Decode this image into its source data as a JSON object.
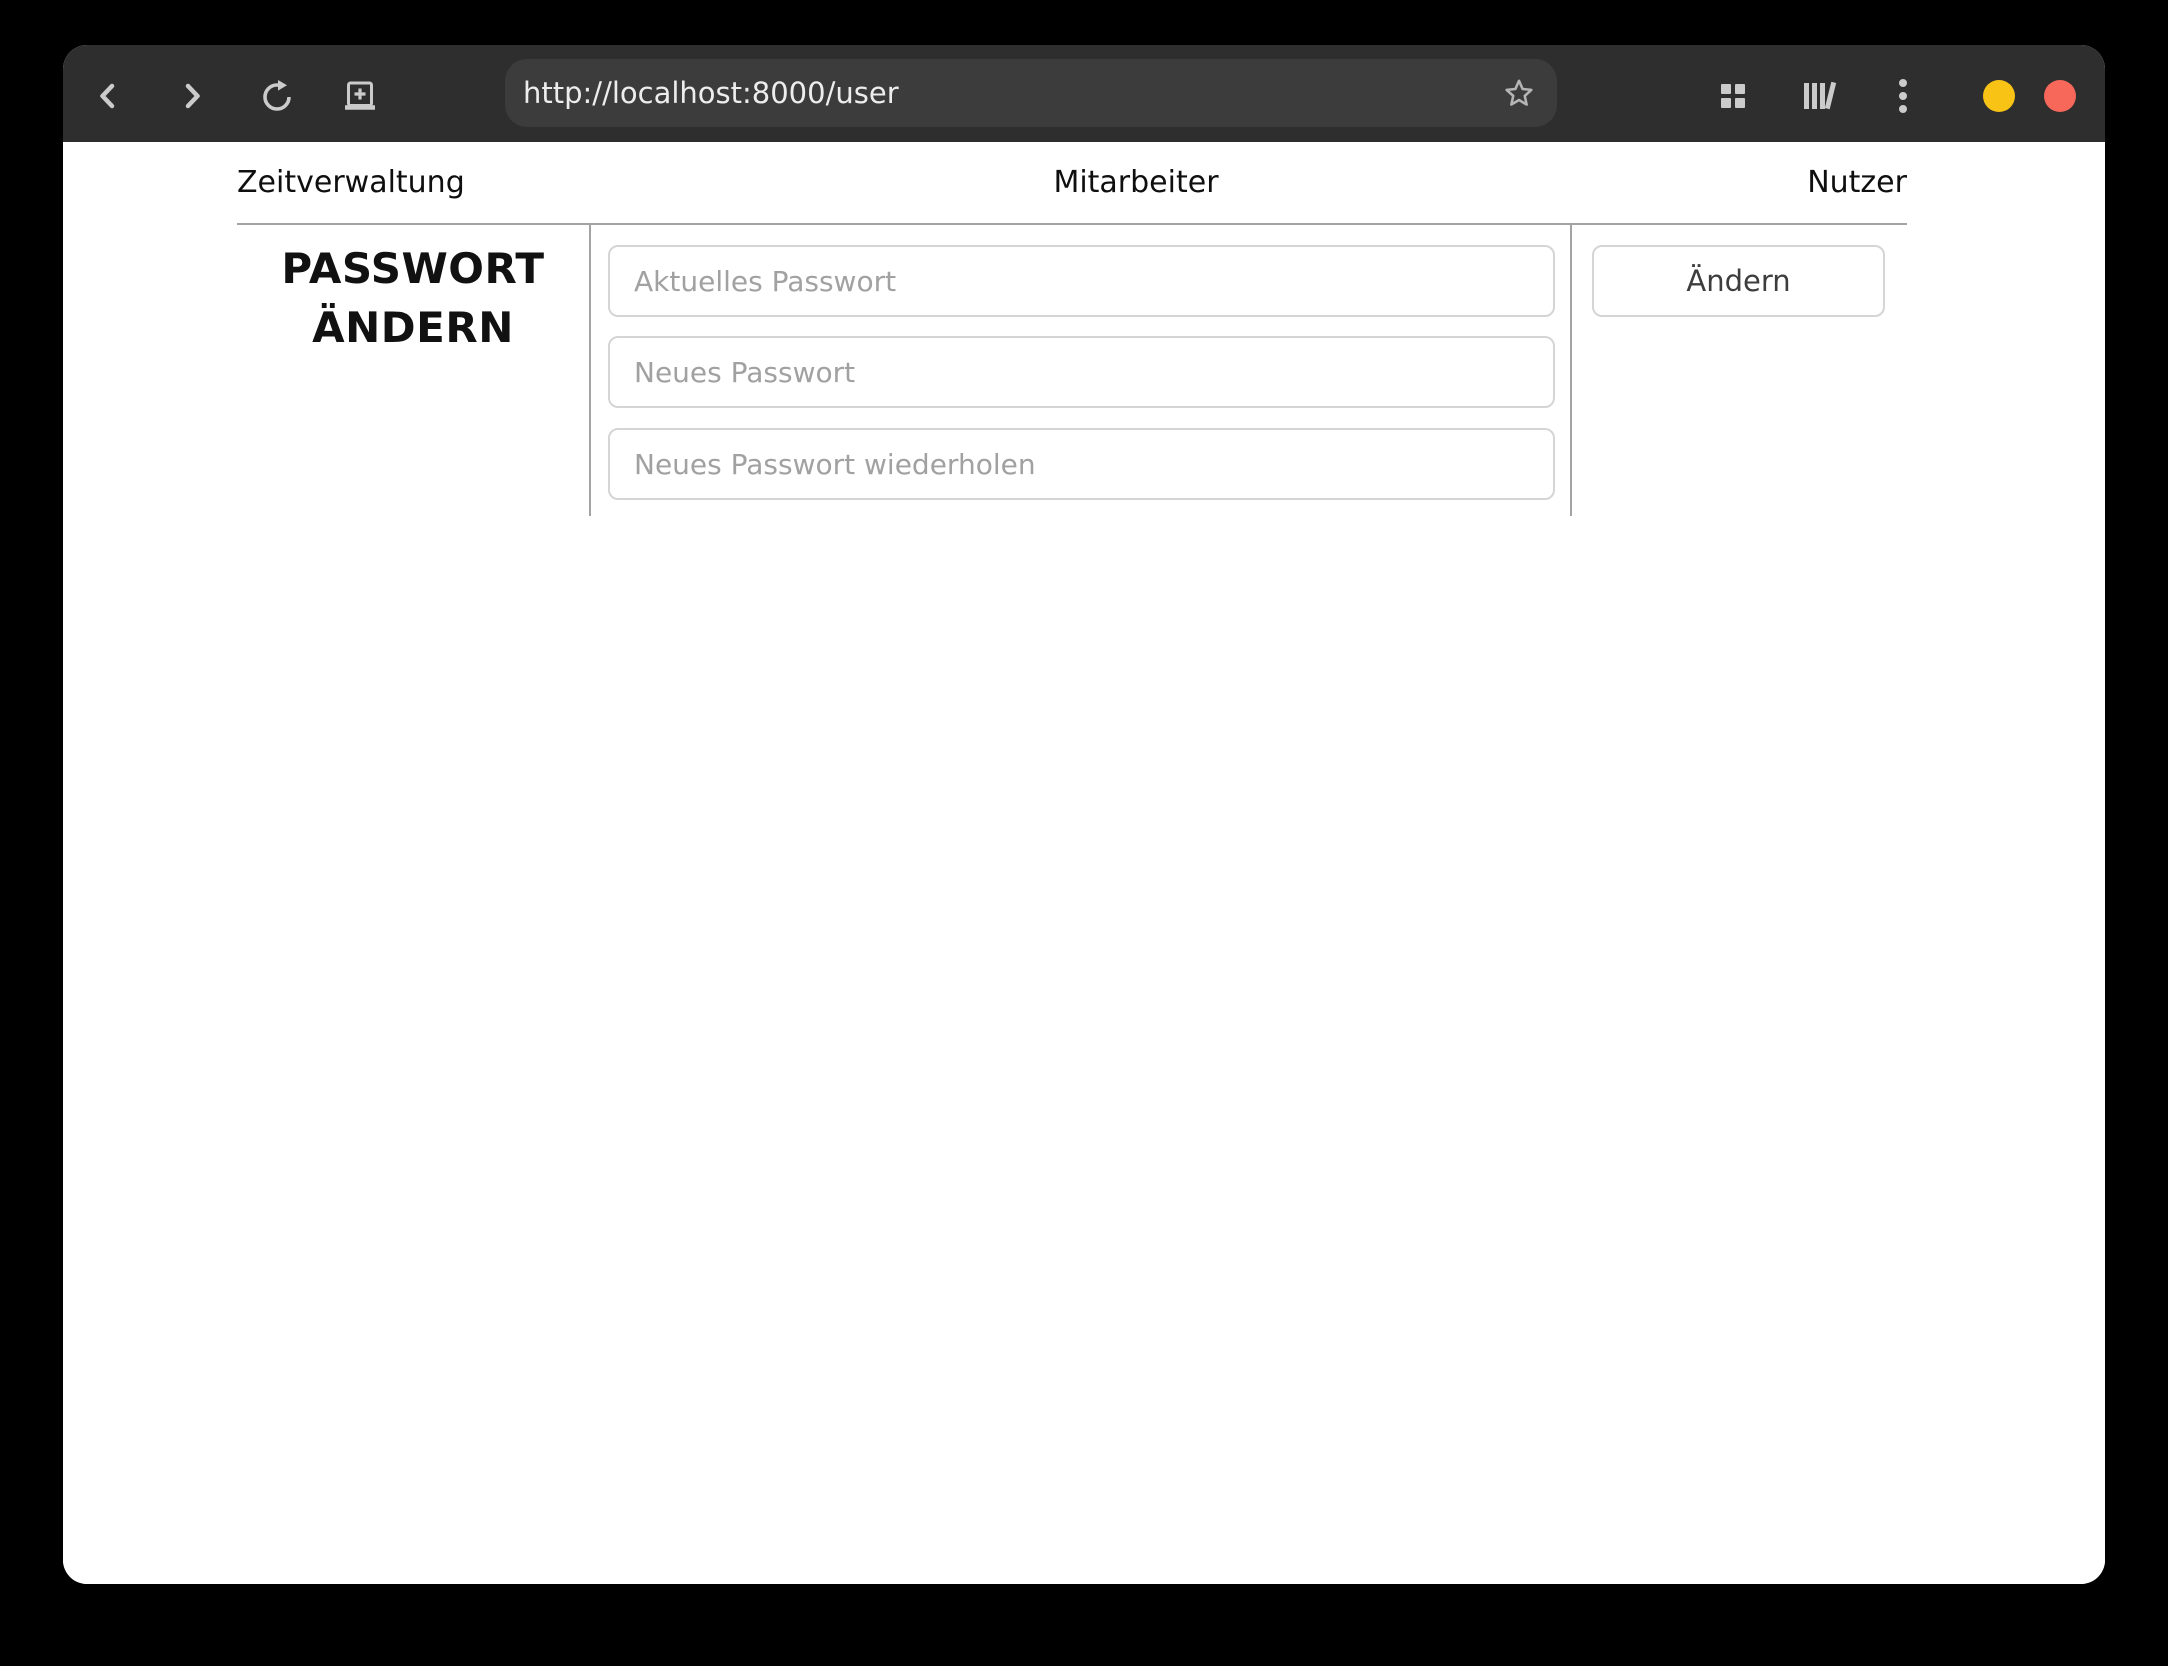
{
  "browser": {
    "url": "http://localhost:8000/user",
    "colors": {
      "chrome_background": "#2e2e2e",
      "urlbar_background": "#3c3c3c",
      "icon_color": "#cbcbcb",
      "page_background": "#ffffff"
    },
    "window_controls": {
      "minimize_color": "#f9c315",
      "close_color": "#f7675a"
    },
    "icons": {
      "back": "chevron-left",
      "forward": "chevron-right",
      "reload": "circular-arrow",
      "new_tab": "window-with-plus",
      "bookmark": "star-outline",
      "tab_overview": "grid-2x2",
      "library": "books",
      "menu": "vertical-dots"
    }
  },
  "page": {
    "nav": {
      "items": [
        {
          "label": "Zeitverwaltung"
        },
        {
          "label": "Mitarbeiter"
        },
        {
          "label": "Nutzer"
        }
      ]
    },
    "password_section": {
      "heading": "PASSWORT ÄNDERN",
      "fields": [
        {
          "placeholder": "Aktuelles Passwort",
          "value": ""
        },
        {
          "placeholder": "Neues Passwort",
          "value": ""
        },
        {
          "placeholder": "Neues Passwort wiederholen",
          "value": ""
        }
      ],
      "submit_label": "Ändern",
      "divider_color": "#a3a3a3",
      "input_border_color": "#d5d5d5"
    }
  }
}
